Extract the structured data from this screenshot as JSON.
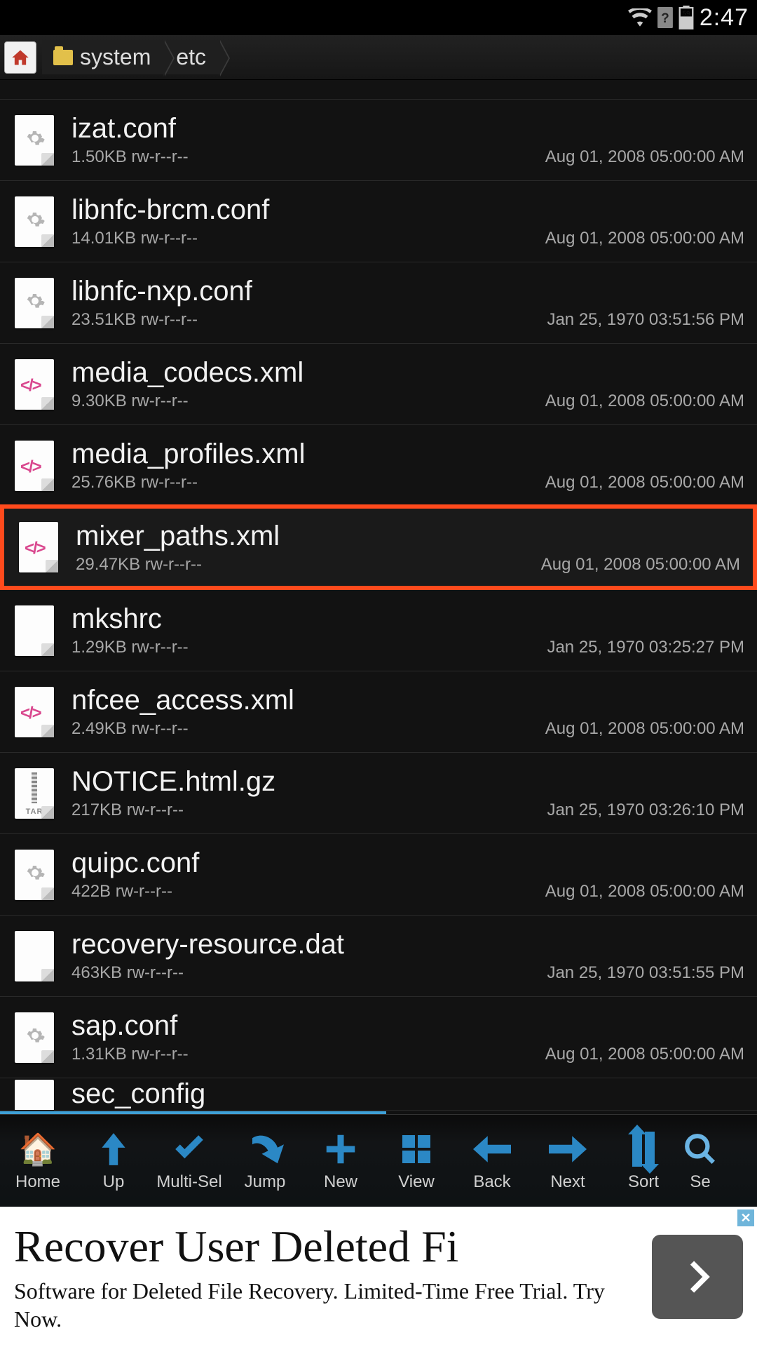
{
  "status": {
    "time": "2:47",
    "battery_label": "59"
  },
  "breadcrumb": {
    "segments": [
      "system",
      "etc"
    ]
  },
  "files": [
    {
      "name": "izat.conf",
      "size": "1.50KB",
      "perm": "rw-r--r--",
      "date": "Aug 01, 2008 05:00:00 AM",
      "icon": "conf"
    },
    {
      "name": "libnfc-brcm.conf",
      "size": "14.01KB",
      "perm": "rw-r--r--",
      "date": "Aug 01, 2008 05:00:00 AM",
      "icon": "conf"
    },
    {
      "name": "libnfc-nxp.conf",
      "size": "23.51KB",
      "perm": "rw-r--r--",
      "date": "Jan 25, 1970 03:51:56 PM",
      "icon": "conf"
    },
    {
      "name": "media_codecs.xml",
      "size": "9.30KB",
      "perm": "rw-r--r--",
      "date": "Aug 01, 2008 05:00:00 AM",
      "icon": "xml"
    },
    {
      "name": "media_profiles.xml",
      "size": "25.76KB",
      "perm": "rw-r--r--",
      "date": "Aug 01, 2008 05:00:00 AM",
      "icon": "xml"
    },
    {
      "name": "mixer_paths.xml",
      "size": "29.47KB",
      "perm": "rw-r--r--",
      "date": "Aug 01, 2008 05:00:00 AM",
      "icon": "xml",
      "highlight": true
    },
    {
      "name": "mkshrc",
      "size": "1.29KB",
      "perm": "rw-r--r--",
      "date": "Jan 25, 1970 03:25:27 PM",
      "icon": "blank"
    },
    {
      "name": "nfcee_access.xml",
      "size": "2.49KB",
      "perm": "rw-r--r--",
      "date": "Aug 01, 2008 05:00:00 AM",
      "icon": "xml"
    },
    {
      "name": "NOTICE.html.gz",
      "size": "217KB",
      "perm": "rw-r--r--",
      "date": "Jan 25, 1970 03:26:10 PM",
      "icon": "tar",
      "tar_label": "TAR"
    },
    {
      "name": "quipc.conf",
      "size": "422B",
      "perm": "rw-r--r--",
      "date": "Aug 01, 2008 05:00:00 AM",
      "icon": "conf"
    },
    {
      "name": "recovery-resource.dat",
      "size": "463KB",
      "perm": "rw-r--r--",
      "date": "Jan 25, 1970 03:51:55 PM",
      "icon": "blank"
    },
    {
      "name": "sap.conf",
      "size": "1.31KB",
      "perm": "rw-r--r--",
      "date": "Aug 01, 2008 05:00:00 AM",
      "icon": "conf"
    },
    {
      "name": "sec_config",
      "size": "",
      "perm": "",
      "date": "",
      "icon": "blank",
      "partial": "bottom"
    }
  ],
  "toolbar": [
    {
      "id": "home",
      "label": "Home",
      "icon": "home"
    },
    {
      "id": "up",
      "label": "Up",
      "icon": "arrow-up"
    },
    {
      "id": "multisel",
      "label": "Multi-Sel",
      "icon": "check"
    },
    {
      "id": "jump",
      "label": "Jump",
      "icon": "jump"
    },
    {
      "id": "new",
      "label": "New",
      "icon": "plus"
    },
    {
      "id": "view",
      "label": "View",
      "icon": "grid"
    },
    {
      "id": "back",
      "label": "Back",
      "icon": "arrow-left"
    },
    {
      "id": "next",
      "label": "Next",
      "icon": "arrow-right"
    },
    {
      "id": "sort",
      "label": "Sort",
      "icon": "sort"
    },
    {
      "id": "search",
      "label": "Se",
      "icon": "search",
      "partial": true
    }
  ],
  "ad": {
    "title": "Recover User Deleted Fi",
    "subtitle": "Software for Deleted File Recovery. Limited-Time Free Trial. Try Now.",
    "cta_icon": "chevron-right"
  }
}
